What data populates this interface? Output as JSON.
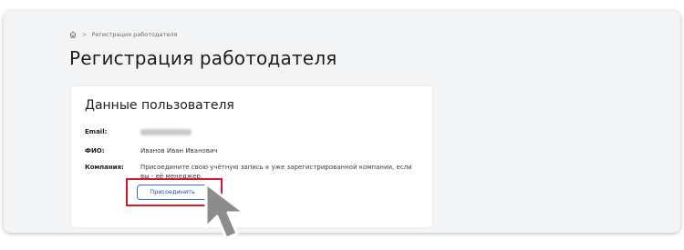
{
  "breadcrumb": {
    "icon": "home-icon",
    "separator": ">",
    "current": "Регистрация работодателя"
  },
  "page": {
    "title": "Регистрация работодателя"
  },
  "card": {
    "title": "Данные пользователя",
    "email": {
      "label": "Email:",
      "value_blurred": true
    },
    "fio": {
      "label": "ФИО:",
      "value": "Иванов Иван Иванович"
    },
    "company": {
      "label": "Компания:",
      "description": "Присоедините свою учётную запись к уже зарегистрированной компании, если вы - её менеджер.",
      "join_button": "Присоединить"
    }
  },
  "annotations": {
    "highlight_color": "#d0192b",
    "cursor_icon": "mouse-pointer-icon"
  }
}
